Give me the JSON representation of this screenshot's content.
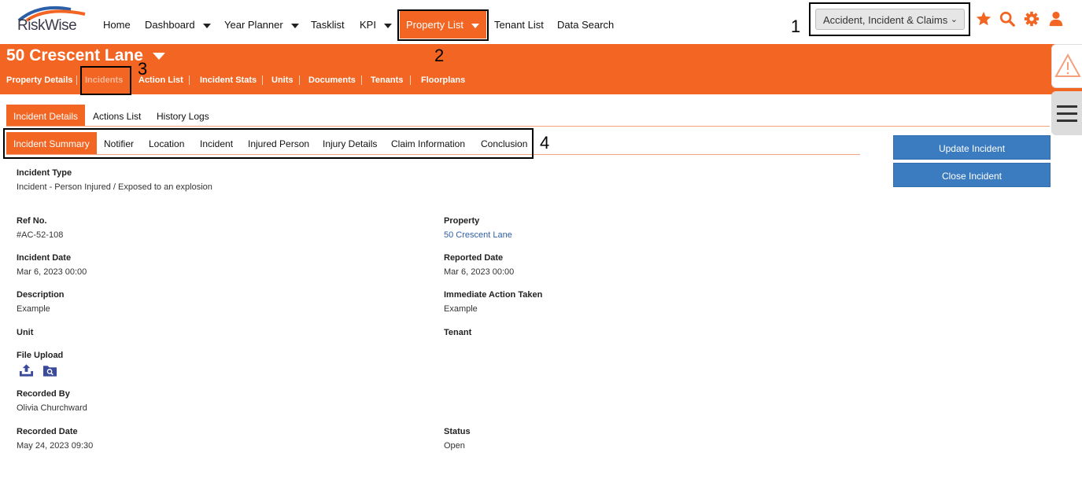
{
  "logo": {
    "text": "RiskWise"
  },
  "nav": {
    "items": [
      "Home",
      "Dashboard",
      "Year Planner",
      "Tasklist",
      "KPI",
      "Property List",
      "Tenant List",
      "Data Search"
    ],
    "module_select": "Accident, Incident & Claims"
  },
  "annotations": [
    "1",
    "2",
    "3",
    "4"
  ],
  "property": {
    "title": "50 Crescent Lane",
    "subnav": [
      "Property Details",
      "Incidents",
      "Action List",
      "Incident Stats",
      "Units",
      "Documents",
      "Tenants",
      "Floorplans"
    ]
  },
  "tabs_primary": [
    "Incident Details",
    "Actions List",
    "History Logs"
  ],
  "tabs_secondary": [
    "Incident Summary",
    "Notifier",
    "Location",
    "Incident",
    "Injured Person",
    "Injury Details",
    "Claim Information",
    "Conclusion"
  ],
  "buttons": {
    "update": "Update Incident",
    "close": "Close Incident"
  },
  "details": {
    "incident_type_label": "Incident Type",
    "incident_type": "Incident - Person Injured / Exposed to an explosion",
    "ref_label": "Ref No.",
    "ref": "#AC-52-108",
    "property_label": "Property",
    "property": "50 Crescent Lane",
    "incident_date_label": "Incident Date",
    "incident_date": "Mar 6, 2023 00:00",
    "reported_date_label": "Reported Date",
    "reported_date": "Mar 6, 2023 00:00",
    "description_label": "Description",
    "description": "Example",
    "immediate_action_label": "Immediate Action Taken",
    "immediate_action": "Example",
    "unit_label": "Unit",
    "tenant_label": "Tenant",
    "file_upload_label": "File Upload",
    "recorded_by_label": "Recorded By",
    "recorded_by": "Olivia Churchward",
    "recorded_date_label": "Recorded Date",
    "recorded_date": "May 24, 2023 09:30",
    "status_label": "Status",
    "status": "Open"
  },
  "colors": {
    "brand_orange": "#f26522",
    "button_blue": "#3b7bbf",
    "link_blue": "#2f5fa6"
  },
  "icons": [
    "star-icon",
    "search-icon",
    "gear-icon",
    "user-icon",
    "warning-icon",
    "hamburger-menu-icon",
    "upload-icon",
    "folder-search-icon"
  ]
}
